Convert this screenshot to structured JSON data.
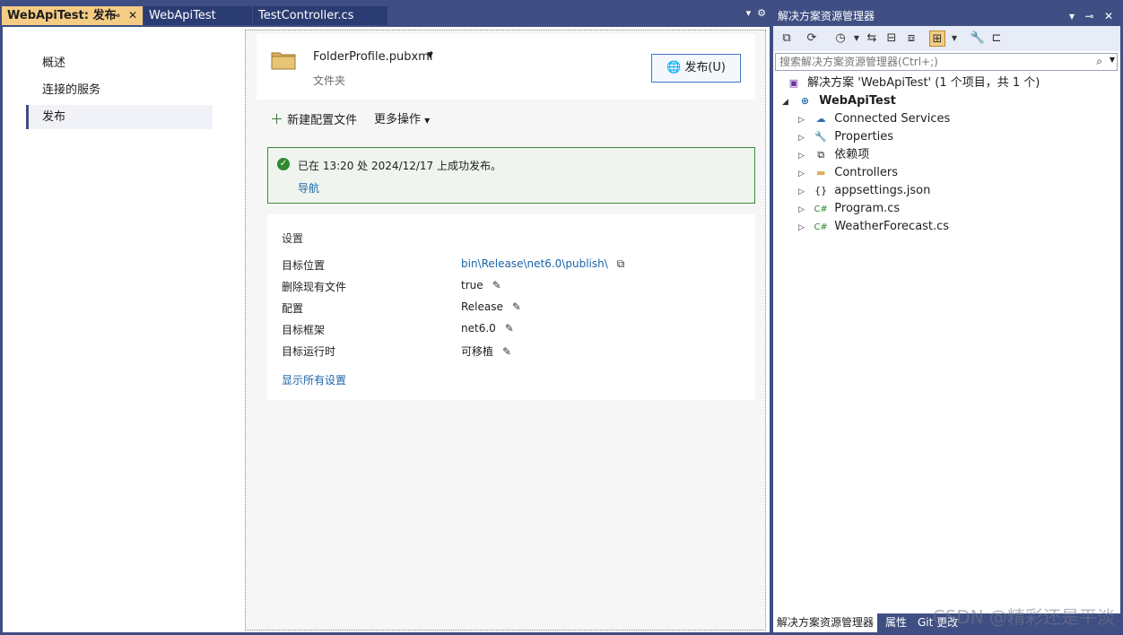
{
  "tabs": [
    {
      "label": "WebApiTest: 发布",
      "active": true
    },
    {
      "label": "WebApiTest",
      "active": false
    },
    {
      "label": "TestController.cs",
      "active": false
    }
  ],
  "editor": {
    "nav": [
      "概述",
      "连接的服务",
      "发布"
    ],
    "profile": {
      "name": "FolderProfile.pubxml",
      "sub": "文件夹",
      "publish_label": "发布(U)"
    },
    "actions": {
      "new_profile": "新建配置文件",
      "more": "更多操作"
    },
    "success": {
      "message": "已在 13:20 处 2024/12/17 上成功发布。",
      "link": "导航"
    },
    "settings": {
      "title": "设置",
      "rows": [
        {
          "key": "目标位置",
          "value": "bin\\Release\\net6.0\\publish\\"
        },
        {
          "key": "删除现有文件",
          "value": "true"
        },
        {
          "key": "配置",
          "value": "Release"
        },
        {
          "key": "目标框架",
          "value": "net6.0"
        },
        {
          "key": "目标运行时",
          "value": "可移植"
        }
      ],
      "show_all": "显示所有设置"
    }
  },
  "solution_explorer": {
    "title": "解决方案资源管理器",
    "search_placeholder": "搜索解决方案资源管理器(Ctrl+;)",
    "solution_label": "解决方案 'WebApiTest' (1 个项目，共 1 个)",
    "project": "WebApiTest",
    "items": [
      "Connected Services",
      "Properties",
      "依赖项",
      "Controllers",
      "appsettings.json",
      "Program.cs",
      "WeatherForecast.cs"
    ],
    "bottom_tabs": [
      "解决方案资源管理器",
      "属性",
      "Git 更改"
    ]
  },
  "watermark": "CSDN @精彩还是平淡"
}
